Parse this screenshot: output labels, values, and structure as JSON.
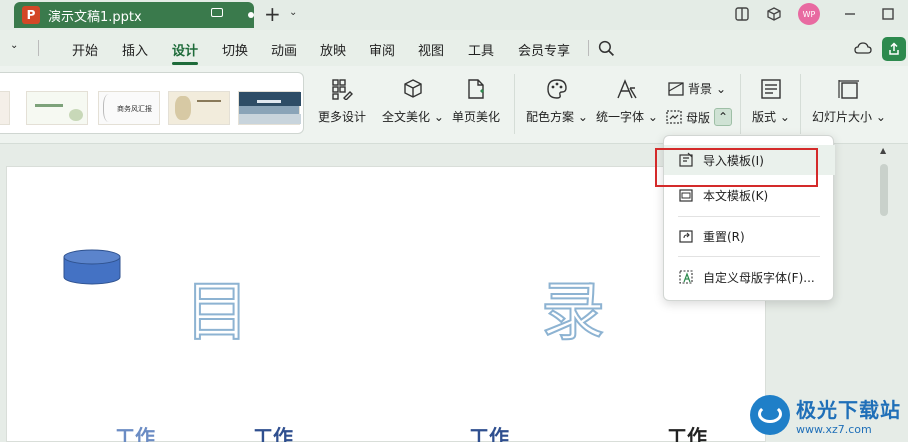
{
  "titlebar": {
    "app_letter": "P",
    "doc_name": "演示文稿1.pptx",
    "avatar_text": "WP"
  },
  "menu": {
    "items": [
      "开始",
      "插入",
      "设计",
      "切换",
      "动画",
      "放映",
      "审阅",
      "视图",
      "工具",
      "会员专享"
    ],
    "active": "设计"
  },
  "ribbon": {
    "more_design": "更多设计",
    "full_beautify": "全文美化",
    "single_beautify": "单页美化",
    "color_scheme": "配色方案",
    "unify_font": "统一字体",
    "background": "背景",
    "master": "母版",
    "layout": "版式",
    "slide_size": "幻灯片大小",
    "thumb_texts": [
      "",
      "",
      "商务风汇报",
      "",
      ""
    ]
  },
  "dropdown": {
    "items": [
      {
        "label": "导入模板(I)",
        "icon": "import-template-icon"
      },
      {
        "label": "本文模板(K)",
        "icon": "this-template-icon"
      },
      {
        "label": "重置(R)",
        "icon": "reset-icon"
      },
      {
        "label": "自定义母版字体(F)...",
        "icon": "custom-font-icon"
      }
    ],
    "highlighted": "导入模板(I)"
  },
  "slide": {
    "char_left": "目",
    "char_right": "录",
    "work_labels": [
      "工作",
      "工作",
      "工作",
      "工作"
    ]
  },
  "watermark": {
    "name": "极光下载站",
    "url": "www.xz7.com"
  },
  "colors": {
    "accent": "#1e6b3a",
    "tab": "#3a7a4c",
    "highlight_box": "#d42a2a"
  }
}
